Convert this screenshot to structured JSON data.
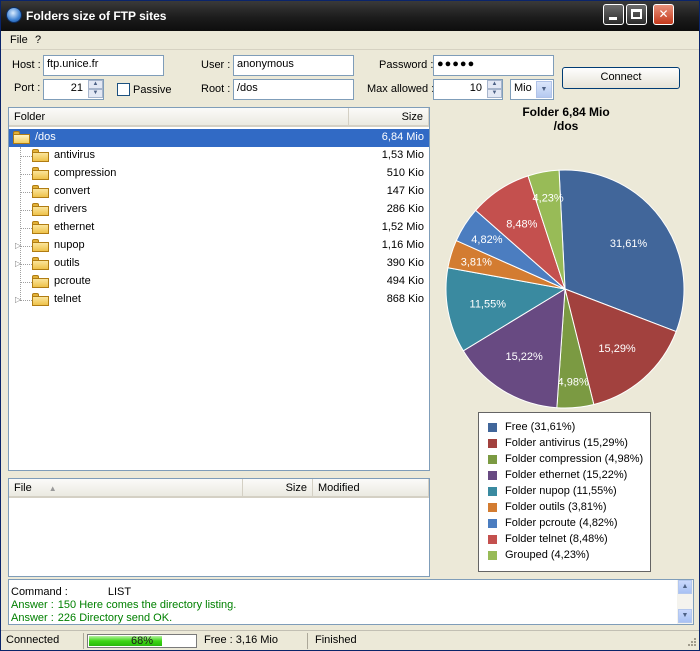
{
  "window": {
    "title": "Folders size of FTP sites"
  },
  "menu": [
    {
      "label": "File"
    },
    {
      "label": "?"
    }
  ],
  "form": {
    "host_label": "Host :",
    "host_value": "ftp.unice.fr",
    "user_label": "User :",
    "user_value": "anonymous",
    "password_label": "Password :",
    "password_value": "●●●●●",
    "port_label": "Port :",
    "port_value": "21",
    "passive_label": "Passive",
    "passive_checked": false,
    "root_label": "Root :",
    "root_value": "/dos",
    "max_allowed_label": "Max allowed :",
    "max_allowed_value": "10",
    "unit_value": "Mio",
    "connect_label": "Connect"
  },
  "tree": {
    "headers": {
      "folder": "Folder",
      "size": "Size"
    },
    "root": {
      "name": "/dos",
      "size": "6,84 Mio"
    },
    "children": [
      {
        "name": "antivirus",
        "size": "1,53 Mio",
        "expandable": false
      },
      {
        "name": "compression",
        "size": "510 Kio",
        "expandable": false
      },
      {
        "name": "convert",
        "size": "147 Kio",
        "expandable": false
      },
      {
        "name": "drivers",
        "size": "286 Kio",
        "expandable": false
      },
      {
        "name": "ethernet",
        "size": "1,52 Mio",
        "expandable": false
      },
      {
        "name": "nupop",
        "size": "1,16 Mio",
        "expandable": true
      },
      {
        "name": "outils",
        "size": "390 Kio",
        "expandable": true
      },
      {
        "name": "pcroute",
        "size": "494 Kio",
        "expandable": false
      },
      {
        "name": "telnet",
        "size": "868 Kio",
        "expandable": true
      }
    ]
  },
  "files": {
    "headers": {
      "file": "File",
      "size": "Size",
      "modified": "Modified"
    }
  },
  "chart_data": {
    "type": "pie",
    "title": "Folder 6,84 Mio",
    "subtitle": "/dos",
    "series": [
      {
        "name": "Free (31,61%)",
        "label": "31,61%",
        "value": 31.61,
        "color": "#41669a"
      },
      {
        "name": "Folder antivirus (15,29%)",
        "label": "15,29%",
        "value": 15.29,
        "color": "#a2413e"
      },
      {
        "name": "Folder compression (4,98%)",
        "label": "4,98%",
        "value": 4.98,
        "color": "#7b9a42"
      },
      {
        "name": "Folder ethernet (15,22%)",
        "label": "15,22%",
        "value": 15.22,
        "color": "#684a82"
      },
      {
        "name": "Folder nupop (11,55%)",
        "label": "11,55%",
        "value": 11.55,
        "color": "#3a8aa0"
      },
      {
        "name": "Folder outils (3,81%)",
        "label": "3,81%",
        "value": 3.81,
        "color": "#d37c31"
      },
      {
        "name": "Folder pcroute (4,82%)",
        "label": "4,82%",
        "value": 4.82,
        "color": "#4b7dc0"
      },
      {
        "name": "Folder telnet (8,48%)",
        "label": "8,48%",
        "value": 8.48,
        "color": "#c4504e"
      },
      {
        "name": "Grouped (4,23%)",
        "label": "4,23%",
        "value": 4.23,
        "color": "#98bb57"
      }
    ],
    "legend": "bottom"
  },
  "log": [
    {
      "prefix": "Command :",
      "text": "LIST",
      "color": "#000000"
    },
    {
      "prefix": "Answer :",
      "text": "150 Here comes the directory listing.",
      "color": "#008000"
    },
    {
      "prefix": "Answer :",
      "text": "226 Directory send OK.",
      "color": "#008000"
    }
  ],
  "status": {
    "connection": "Connected",
    "progress": 68,
    "progress_text": "68%",
    "free": "Free : 3,16 Mio",
    "state": "Finished"
  }
}
